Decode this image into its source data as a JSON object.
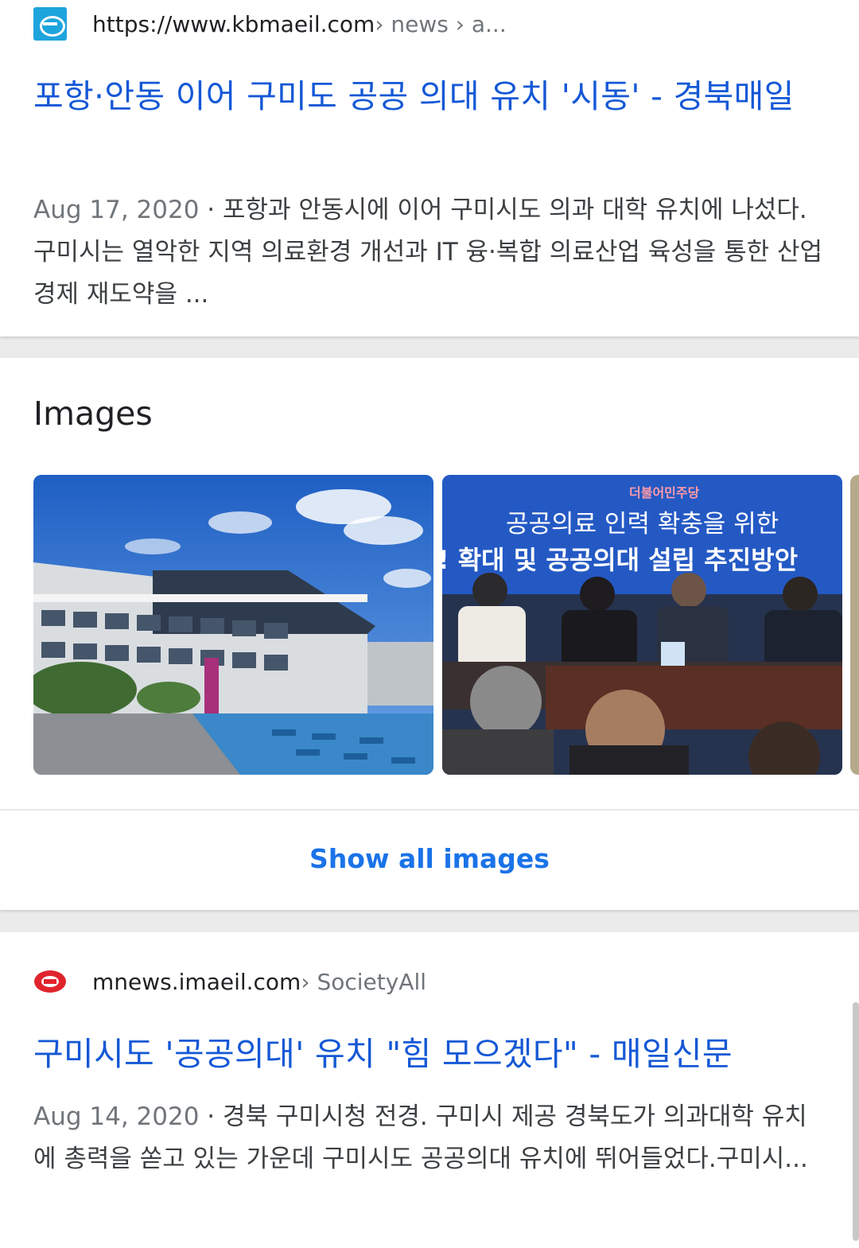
{
  "results": [
    {
      "url_main": "https://www.kbmaeil.com",
      "url_crumb": " › news › a...",
      "title": "포항·안동 이어 구미도 공공 의대 유치 '시동' - 경북매일",
      "date": "Aug 17, 2020",
      "snippet": " · 포항과 안동시에 이어 구미시도 의과 대학 유치에 나섰다. 구미시는 열악한 지역 의료환경 개선과 IT 융·복합 의료산업 육성을 통한 산업경제 재도약을 ..."
    },
    {
      "url_main": "mnews.imaeil.com",
      "url_crumb": " › SocietyAll",
      "title": "구미시도 '공공의대' 유치 \"힘 모으겠다\" - 매일신문",
      "date": "Aug 14, 2020",
      "snippet": " · 경북 구미시청 전경. 구미시 제공 경북도가 의과대학 유치에 총력을 쏟고 있는 가운데 구미시도 공공의대 유치에 뛰어들었다.구미시..."
    }
  ],
  "images": {
    "heading": "Images",
    "show_all": "Show all images",
    "banner_party": "더불어민주당",
    "banner_line1": "공공의료 인력 확충을 위한",
    "banner_line2": "! 확대 및 공공의대 설립 추진방안"
  },
  "colors": {
    "link": "#1558d6",
    "show_all": "#1a73e8",
    "kb_favicon": "#1ea4dc",
    "imaeil_favicon": "#e0242d"
  },
  "icons": {
    "result1_favicon": "kbmaeil-logo-icon",
    "result2_favicon": "imaeil-logo-icon"
  }
}
